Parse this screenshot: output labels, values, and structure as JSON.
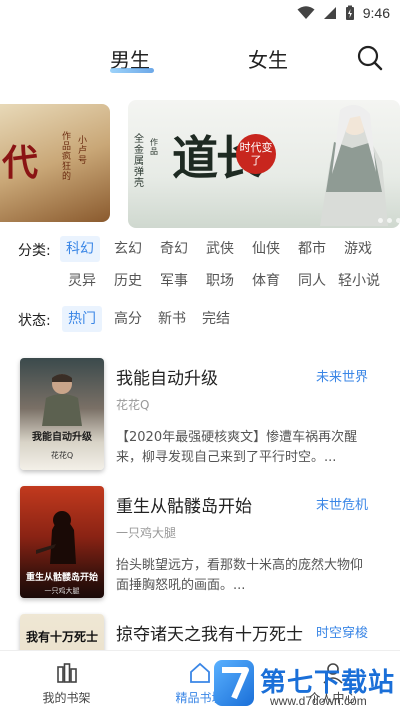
{
  "status_bar": {
    "time": "9:46"
  },
  "header": {
    "tabs": [
      {
        "label": "男生",
        "active": true
      },
      {
        "label": "女生",
        "active": false
      }
    ],
    "search_icon": "search-icon"
  },
  "banner": {
    "left": {
      "big_text": "代",
      "side_text_1": "作品疯狂的",
      "side_text_2": "小卢号"
    },
    "main": {
      "title": "道长",
      "tag": "时代变了",
      "side_text_1": "全金属弹壳",
      "side_text_2": "作品"
    }
  },
  "filters": {
    "category": {
      "label": "分类:",
      "options": [
        "科幻",
        "玄幻",
        "奇幻",
        "武侠",
        "仙侠",
        "都市",
        "游戏",
        "灵异",
        "历史",
        "军事",
        "职场",
        "体育",
        "同人",
        "轻小说"
      ],
      "selected": "科幻"
    },
    "status": {
      "label": "状态:",
      "options": [
        "热门",
        "高分",
        "新书",
        "完结"
      ],
      "selected": "热门"
    }
  },
  "books": [
    {
      "title": "我能自动升级",
      "author": "花花Q",
      "tag": "未来世界",
      "description": "【2020年最强硬核爽文】惨遭车祸再次醒来，柳寻发现自己来到了平行时空。...",
      "cover_title": "我能自动升级",
      "cover_author": "花花Q"
    },
    {
      "title": "重生从骷髅岛开始",
      "author": "一只鸡大腿",
      "tag": "末世危机",
      "description": "抬头眺望远方，看那数十米高的庞然大物仰面捶胸怒吼的画面。...",
      "cover_title": "重生从骷髅岛开始",
      "cover_author": "一只鸡大腿"
    },
    {
      "title": "掠夺诸天之我有十万死士",
      "author": "",
      "tag": "时空穿梭",
      "description": "",
      "cover_title": "我有十万死士",
      "cover_author": ""
    }
  ],
  "bottom_nav": [
    {
      "label": "我的书架",
      "icon": "bookshelf-icon",
      "active": false
    },
    {
      "label": "精品书城",
      "icon": "home-icon",
      "active": true
    },
    {
      "label": "个人中心",
      "icon": "user-icon",
      "active": false
    }
  ],
  "watermark": {
    "brand": "第七下载站",
    "url": "www.d7down.com"
  },
  "colors": {
    "accent": "#3a86e6",
    "chip_bg": "#eaf3fe",
    "text": "#222222",
    "muted": "#999999"
  }
}
